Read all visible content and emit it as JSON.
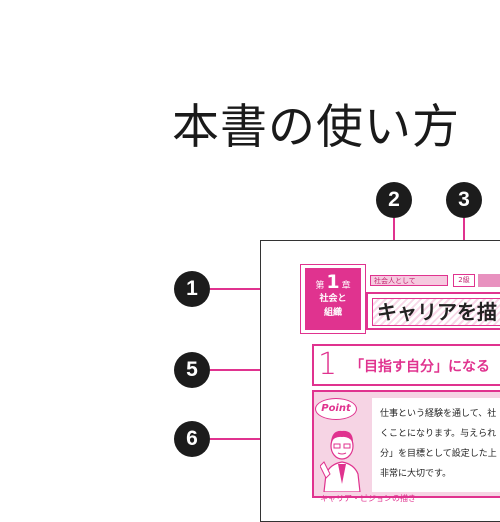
{
  "title": "本書の使い方",
  "badges": {
    "b1": "1",
    "b2": "2",
    "b3": "3",
    "b5": "5",
    "b6": "6"
  },
  "chapter": {
    "prefix": "第",
    "number": "1",
    "suffix": "章",
    "name_line1": "社会と",
    "name_line2": "組織"
  },
  "tag_label": "社会人として",
  "level_label": "2級",
  "heading": "キャリアを描",
  "section": {
    "number": "1",
    "title": "「目指す自分」になる"
  },
  "point": {
    "label": "Point",
    "lines": [
      "仕事という経験を通して、社",
      "くことになります。与えられ",
      "分」を目標として設定した上",
      "非常に大切です。"
    ]
  },
  "bottom_fragment": "キャリア・ビジョンの描き",
  "colors": {
    "accent": "#e0338f",
    "accent_light": "#f6d4e4",
    "badge": "#1c1c1c"
  }
}
